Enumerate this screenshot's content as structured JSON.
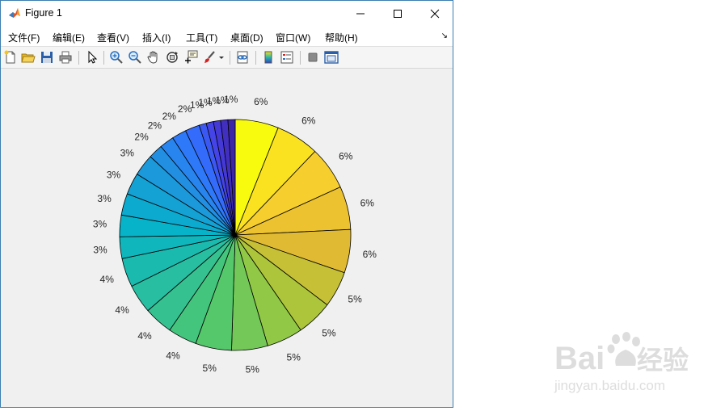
{
  "window": {
    "title": "Figure 1"
  },
  "menu": {
    "items": [
      {
        "label": "文件(F)"
      },
      {
        "label": "编辑(E)"
      },
      {
        "label": "查看(V)"
      },
      {
        "label": "插入(I)"
      },
      {
        "label": "工具(T)"
      },
      {
        "label": "桌面(D)"
      },
      {
        "label": "窗口(W)"
      },
      {
        "label": "帮助(H)"
      }
    ]
  },
  "toolbar": {
    "icons": [
      "new-figure-icon",
      "open-file-icon",
      "save-icon",
      "print-icon",
      "pointer-icon",
      "zoom-in-icon",
      "zoom-out-icon",
      "pan-icon",
      "rotate-3d-icon",
      "data-cursor-icon",
      "brush-icon",
      "link-plot-icon",
      "colorbar-icon",
      "legend-icon",
      "hide-plot-tools-icon",
      "show-plot-tools-icon"
    ]
  },
  "chart_data": {
    "type": "pie",
    "colormap": "parula",
    "values": [
      6,
      6,
      6,
      6,
      6,
      5,
      5,
      5,
      5,
      5,
      4,
      4,
      4,
      4,
      3,
      3,
      3,
      3,
      3,
      2,
      2,
      2,
      2,
      1,
      1,
      1,
      1,
      1
    ],
    "labels": [
      "6%",
      "6%",
      "6%",
      "6%",
      "6%",
      "5%",
      "5%",
      "5%",
      "5%",
      "5%",
      "4%",
      "4%",
      "4%",
      "4%",
      "3%",
      "3%",
      "3%",
      "3%",
      "3%",
      "2%",
      "2%",
      "2%",
      "2%",
      "1%",
      "1%",
      "1%",
      "1%",
      "1%"
    ]
  },
  "watermark": {
    "brand": "Baidu经验",
    "url": "jingyan.baidu.com"
  }
}
